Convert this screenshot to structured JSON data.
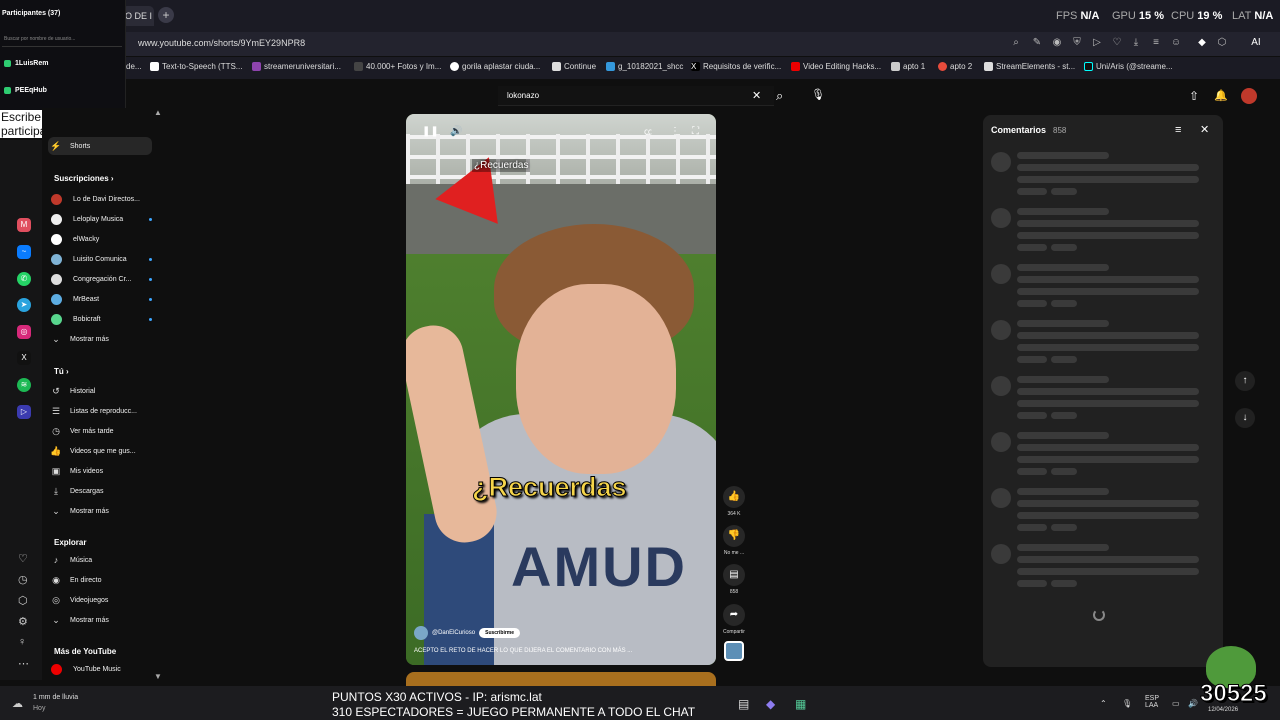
{
  "browser": {
    "tab_title": "O DE I",
    "url": "www.youtube.com/shorts/9YmEY29NPR8",
    "perf": {
      "fps_label": "FPS",
      "fps_value": "N/A",
      "gpu_label": "GPU",
      "gpu_value": "15 %",
      "cpu_label": "CPU",
      "cpu_value": "19 %",
      "lat_label": "LAT",
      "lat_value": "N/A"
    },
    "ai_label": "AI",
    "bookmarks": [
      "de...",
      "Text-to-Speech (TTS...",
      "streameruniversitari...",
      "40.000+ Fotos y Im...",
      "gorila aplastar ciuda...",
      "Continue",
      "g_10182021_shcc",
      "Requisitos de verific...",
      "Video Editing Hacks...",
      "apto 1",
      "apto 2",
      "StreamElements - st...",
      "Uni/Aris (@streame..."
    ]
  },
  "participants": {
    "title": "Participantes (37)",
    "search_placeholder": "Buscar por nombre de usuario...",
    "items": [
      "1LuisRem",
      "PEEqHub"
    ]
  },
  "notice": "Escribe !aris para participar en el sorteo",
  "sidebar": {
    "shorts": "Shorts",
    "subs_header": "Suscripciones",
    "subs": [
      "Lo de Davi Directos...",
      "Leloplay Musica",
      "elWacky",
      "Luisito Comunica",
      "Congregación Cr...",
      "MrBeast",
      "Bobicraft"
    ],
    "more1": "Mostrar más",
    "you_header": "Tú",
    "you": [
      "Historial",
      "Listas de reproducc...",
      "Ver más tarde",
      "Videos que me gus...",
      "Mis videos",
      "Descargas"
    ],
    "more2": "Mostrar más",
    "explore_header": "Explorar",
    "explore": [
      "Música",
      "En directo",
      "Videojuegos"
    ],
    "more3": "Mostrar más",
    "yt_header": "Más de YouTube",
    "yt_music": "YouTube Music"
  },
  "search": {
    "query": "lokonazo"
  },
  "video": {
    "caption_top": "¿Recuerdas",
    "caption_big": "¿Recuerdas",
    "shirt_text": "AMUD",
    "channel": "@DanElCurioso",
    "subscribe": "Suscribirme",
    "description": "ACEPTO EL RETO DE HACER LO QUE DIJERA EL COMENTARIO CON MÁS ..."
  },
  "actions": {
    "likes": "364 K",
    "dislike": "No me ...",
    "comments": "858",
    "share": "Compartir"
  },
  "comments": {
    "title": "Comentarios",
    "count": "858"
  },
  "stream": {
    "line1": "PUNTOS X30 ACTIVOS - IP: arismc.lat",
    "line2": "310 ESPECTADORES = JUEGO PERMANENTE A TODO EL CHAT",
    "counter": "30525"
  },
  "taskbar": {
    "weather": "1 mm de lluvia",
    "weather_sub": "Hoy",
    "lang": "ESP",
    "lang_sub": "LAA",
    "date": "12/04/2026"
  }
}
